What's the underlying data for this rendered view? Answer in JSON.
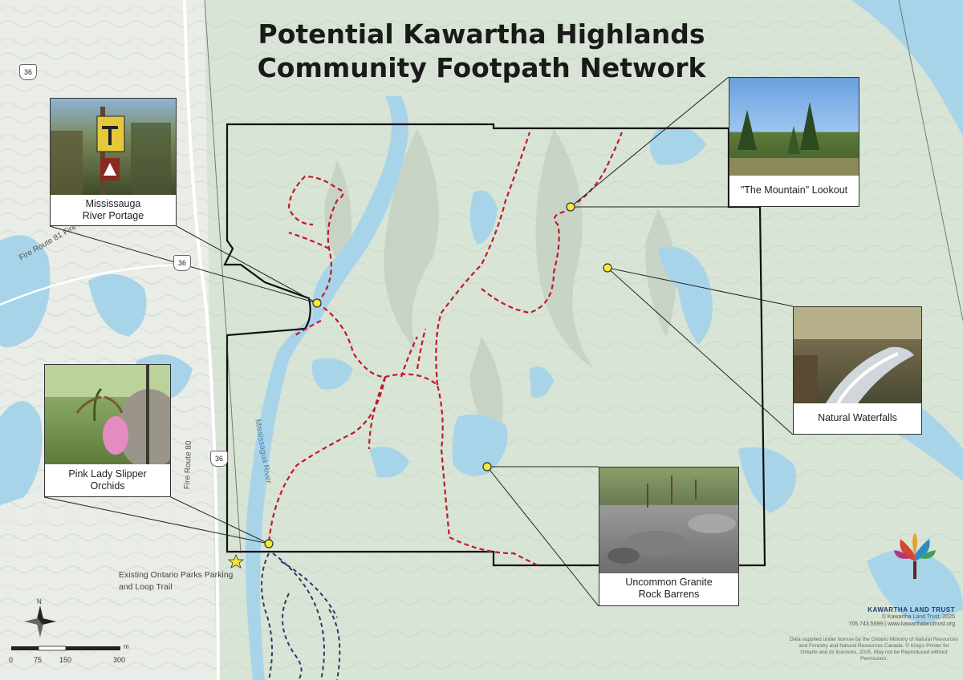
{
  "map": {
    "title_line1": "Potential Kawartha Highlands",
    "title_line2": "Community Footpath Network",
    "colors": {
      "water": "#a8d4ea",
      "land": "#dde6dc",
      "outside": "#eceeea",
      "boundary": "#111111",
      "trail_proposed": "#c0182b",
      "trail_existing": "#2b3a6b",
      "poi": "#f4ea3a"
    },
    "roads": {
      "hwy_shield": "36",
      "fire_route_81": "Fire Route 81 Fire Ro",
      "fire_route_80": "Fire Route 80",
      "river": "Mississagua River",
      "shield_2": "36",
      "shield_3": "36"
    },
    "callouts": [
      {
        "caption": "Mississauga\nRiver Portage",
        "photo": "trail-sign-photo"
      },
      {
        "caption": "Pink Lady Slipper\nOrchids",
        "photo": "orchid-photo"
      },
      {
        "caption": "\"The Mountain\" Lookout",
        "photo": "lookout-photo"
      },
      {
        "caption": "Natural Waterfalls",
        "photo": "waterfall-photo"
      },
      {
        "caption": "Uncommon Granite\nRock Barrens",
        "photo": "granite-photo"
      }
    ],
    "parking_label_1": "Existing Ontario Parks Parking",
    "parking_label_2": "and Loop Trail",
    "scale": {
      "labels": [
        "0",
        "75",
        "150",
        "300"
      ],
      "unit": "m"
    },
    "north_label": "N",
    "brand": {
      "name": "KAWARTHA LAND TRUST",
      "copyright": "© Kawartha Land Trust, 2025",
      "contact": "705.743.5599 | www.kawarthalandtrust.org"
    },
    "disclaimer": "Data supplied under license by the Ontario Ministry of Natural Resources and Forestry and Natural Resources Canada. © King's Printer for Ontario and its licensors, 2025. May not be Reproduced without Permission."
  }
}
